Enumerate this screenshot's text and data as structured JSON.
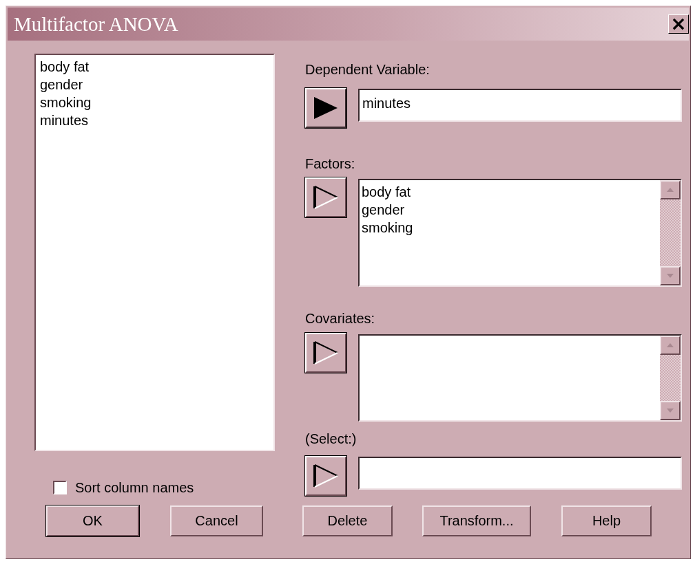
{
  "window": {
    "title": "Multifactor ANOVA",
    "close": "×"
  },
  "variables": [
    "body fat",
    "gender",
    "smoking",
    "minutes"
  ],
  "sort_checkbox": {
    "label": "Sort column names",
    "checked": false
  },
  "slots": [
    {
      "kind": "field",
      "label": "Dependent Variable:",
      "arrow_enabled": true,
      "value": "minutes"
    },
    {
      "kind": "list",
      "label": "Factors:",
      "arrow_enabled": false,
      "items": [
        "body fat",
        "gender",
        "smoking"
      ]
    },
    {
      "kind": "list",
      "label": "Covariates:",
      "arrow_enabled": false
    },
    {
      "kind": "field",
      "label": "(Select:)",
      "arrow_enabled": false
    }
  ],
  "buttons": [
    {
      "label": "OK",
      "default": true
    },
    {
      "label": "Cancel",
      "default": false
    },
    {
      "label": "Delete",
      "default": false
    },
    {
      "label": "Transform...",
      "default": false
    },
    {
      "label": "Help",
      "default": false
    }
  ]
}
